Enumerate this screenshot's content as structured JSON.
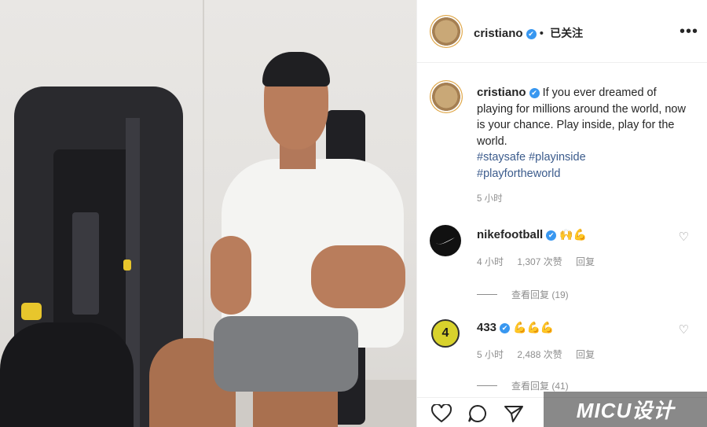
{
  "header": {
    "username": "cristiano",
    "verified_icon": "✔",
    "separator": "•",
    "follow_status": "已关注",
    "more_icon": "•••"
  },
  "caption": {
    "username": "cristiano",
    "text": "If you ever dreamed of playing for millions around the world, now is your chance. Play inside, play for the world.",
    "hashtags": [
      "#staysafe",
      "#playinside",
      "#playfortheworld"
    ],
    "time": "5 小时"
  },
  "comments": [
    {
      "username": "nikefootball",
      "avatar_icon": "nike-swoosh-icon",
      "text": "🙌💪",
      "time": "4 小时",
      "likes": "1,307 次赞",
      "reply_label": "回复",
      "view_replies": "查看回复 (19)"
    },
    {
      "username": "433",
      "avatar_icon": "433-logo-icon",
      "avatar_text": "4",
      "text": "💪💪💪",
      "time": "5 小时",
      "likes": "2,488 次赞",
      "reply_label": "回复",
      "view_replies": "查看回复 (41)"
    }
  ],
  "actions": {
    "like_icon": "heart-outline-icon",
    "comment_icon": "comment-bubble-icon",
    "share_icon": "paper-plane-icon"
  },
  "watermark": "MICU设计"
}
